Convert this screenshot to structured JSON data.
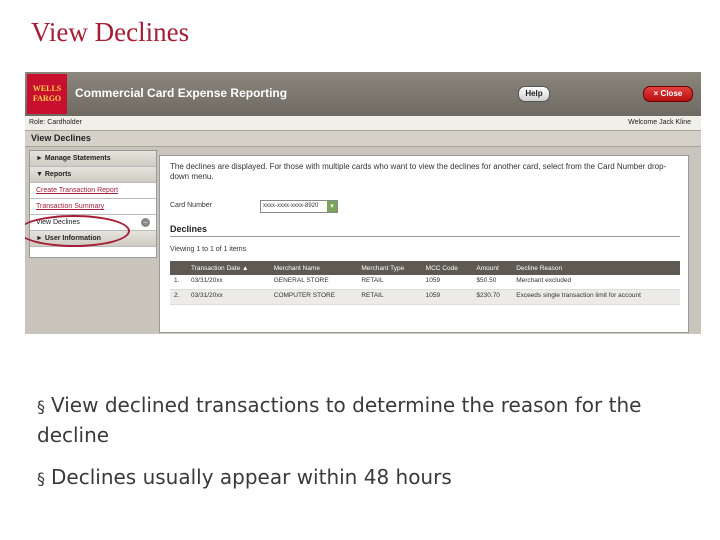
{
  "slide": {
    "title": "View Declines",
    "bullets": [
      "View declined transactions to determine the reason for the decline",
      "Declines usually appear within 48 hours"
    ],
    "bullet_mark": "§",
    "accent_color": "#a41e36"
  },
  "app": {
    "logo_line1": "WELLS",
    "logo_line2": "FARGO",
    "title": "Commercial Card Expense Reporting",
    "help_label": "Help",
    "close_label": "× Close",
    "role_label": "Role: Cardholder",
    "welcome_text": "Welcome Jack Kline",
    "page_heading": "View Declines"
  },
  "sidebar": {
    "items": [
      {
        "label": "► Manage Statements"
      },
      {
        "label": "▼ Reports"
      },
      {
        "label": "Create Transaction Report"
      },
      {
        "label": "Transaction Summary"
      },
      {
        "label": "View Declines"
      },
      {
        "label": "► User Information"
      }
    ]
  },
  "main": {
    "intro": "The declines are displayed. For those with multiple cards who want to view the declines for another card, select from the Card Number drop-down menu.",
    "card_number_label": "Card Number",
    "card_number_value": "xxxx-xxxx-xxxx-8920",
    "section_title": "Declines",
    "viewing_text": "Viewing 1 to 1 of 1 items",
    "columns": [
      "",
      "Transaction Date ▲",
      "Merchant Name",
      "Merchant Type",
      "MCC Code",
      "Amount",
      "Decline Reason"
    ],
    "rows": [
      [
        "1.",
        "03/31/20xx",
        "GENERAL STORE",
        "RETAIL",
        "1059",
        "$50.50",
        "Merchant excluded"
      ],
      [
        "2.",
        "03/31/20xx",
        "COMPUTER STORE",
        "RETAIL",
        "1059",
        "$230.70",
        "Exceeds single transaction limit for account"
      ]
    ]
  }
}
